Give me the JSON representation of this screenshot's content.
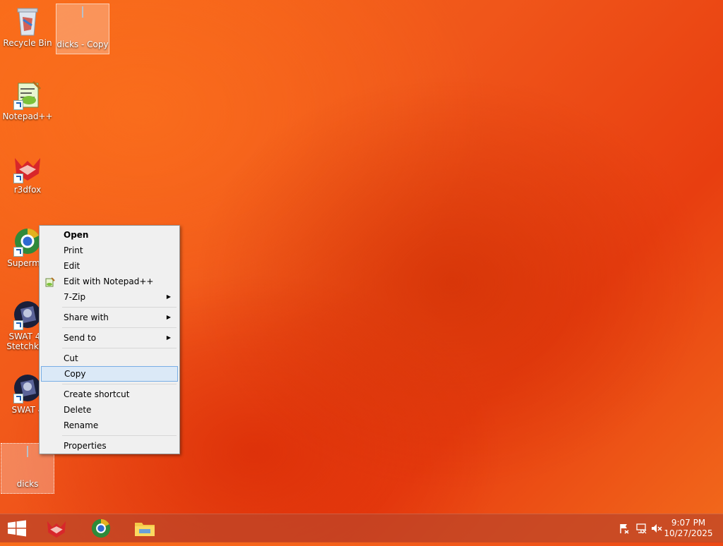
{
  "desktop": {
    "icons": [
      {
        "label": "Recycle Bin"
      },
      {
        "label": "dicks - Copy"
      },
      {
        "label": "Notepad++"
      },
      {
        "label": "r3dfox"
      },
      {
        "label": "Supermiu"
      },
      {
        "label": "SWAT 4 -\nStetchkov"
      },
      {
        "label": "SWAT 4"
      },
      {
        "label": "dicks"
      }
    ]
  },
  "context_menu": {
    "items": [
      {
        "label": "Open"
      },
      {
        "label": "Print"
      },
      {
        "label": "Edit"
      },
      {
        "label": "Edit with Notepad++"
      },
      {
        "label": "7-Zip"
      },
      {
        "label": "Share with"
      },
      {
        "label": "Send to"
      },
      {
        "label": "Cut"
      },
      {
        "label": "Copy"
      },
      {
        "label": "Create shortcut"
      },
      {
        "label": "Delete"
      },
      {
        "label": "Rename"
      },
      {
        "label": "Properties"
      }
    ]
  },
  "taskbar": {
    "time": "9:07 PM",
    "date": "10/27/2025"
  },
  "colors": {
    "accent": "#dbe9f7",
    "accent_border": "#78aee5"
  }
}
